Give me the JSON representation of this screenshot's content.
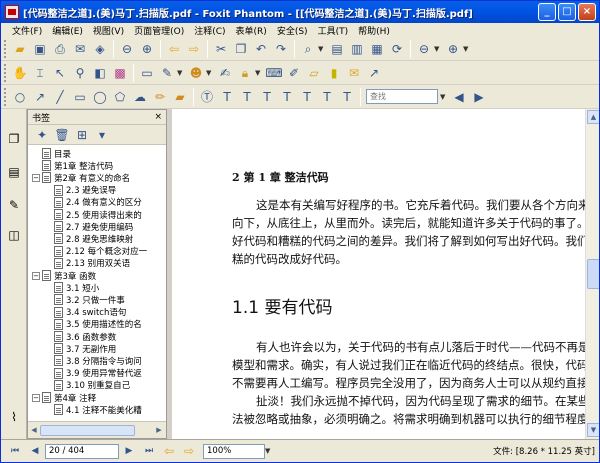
{
  "window": {
    "title": "[代码整洁之道].(美)马丁.扫描版.pdf - Foxit Phantom - [[代码整洁之道].(美)马丁.扫描版.pdf]",
    "min_label": "_",
    "max_label": "□",
    "close_label": "×"
  },
  "menubar": [
    "文件(F)",
    "编辑(E)",
    "视图(V)",
    "页面管理(O)",
    "注释(C)",
    "表单(R)",
    "安全(S)",
    "工具(T)",
    "帮助(H)"
  ],
  "toolbar": {
    "search_placeholder": "查找"
  },
  "bookmarks": {
    "header": "书签",
    "close_label": "×",
    "items": [
      {
        "label": "目录",
        "level": 1,
        "expander": ""
      },
      {
        "label": "第1章 整洁代码",
        "level": 1,
        "expander": ""
      },
      {
        "label": "第2章 有意义的命名",
        "level": 0,
        "expander": "−"
      },
      {
        "label": "2.3 避免误导",
        "level": 2,
        "expander": ""
      },
      {
        "label": "2.4 做有意义的区分",
        "level": 2,
        "expander": ""
      },
      {
        "label": "2.5 使用读得出来的",
        "level": 2,
        "expander": ""
      },
      {
        "label": "2.7 避免使用编码",
        "level": 2,
        "expander": ""
      },
      {
        "label": "2.8 避免思维映射",
        "level": 2,
        "expander": ""
      },
      {
        "label": "2.12 每个概念对应一",
        "level": 2,
        "expander": ""
      },
      {
        "label": "2.13 别用双关语",
        "level": 2,
        "expander": ""
      },
      {
        "label": "第3章 函数",
        "level": 0,
        "expander": "−"
      },
      {
        "label": "3.1 短小",
        "level": 2,
        "expander": ""
      },
      {
        "label": "3.2 只做一件事",
        "level": 2,
        "expander": ""
      },
      {
        "label": "3.4 switch语句",
        "level": 2,
        "expander": ""
      },
      {
        "label": "3.5 使用描述性的名",
        "level": 2,
        "expander": ""
      },
      {
        "label": "3.6 函数参数",
        "level": 2,
        "expander": ""
      },
      {
        "label": "3.7 无副作用",
        "level": 2,
        "expander": ""
      },
      {
        "label": "3.8 分隔指令与询问",
        "level": 2,
        "expander": ""
      },
      {
        "label": "3.9 使用异常替代返",
        "level": 2,
        "expander": ""
      },
      {
        "label": "3.10 别重复自己",
        "level": 2,
        "expander": ""
      },
      {
        "label": "第4章 注释",
        "level": 0,
        "expander": "−"
      },
      {
        "label": "4.1 注释不能美化糟",
        "level": 2,
        "expander": ""
      }
    ]
  },
  "document": {
    "chapter_heading": "2    第 1 章    整洁代码",
    "lines_1": [
      "这是本有关编写好程序的书。它充斥着代码。我们要从各个方向来",
      "向下，从底往上，从里而外。读完后，就能知道许多关于代码的事了。",
      "好代码和糟糕的代码之间的差异。我们将了解到如何写出好代码。我们",
      "糕的代码改成好代码。"
    ],
    "section_heading": "1.1    要有代码",
    "lines_2": [
      "有人也许会以为，关于代码的书有点儿落后于时代——代码不再是",
      "模型和需求。确实，有人说过我们正在临近代码的终结点。很快，代码",
      "不需要再人工编写。程序员完全没用了，因为商务人士可以从规约直接",
      "扯淡！我们永远抛不掉代码，因为代码呈现了需求的细节。在某些",
      "法被忽略或抽象，必须明确之。将需求明确到机器可以执行的细节程度"
    ]
  },
  "statusbar": {
    "page_indicator": "20 / 404",
    "zoom": "100%",
    "file_info": "文件: [8.26 * 11.25 英寸]"
  }
}
